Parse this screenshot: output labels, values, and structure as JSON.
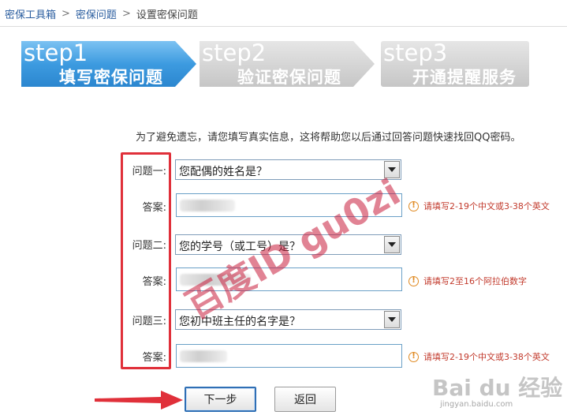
{
  "breadcrumb": {
    "items": [
      "密保工具箱",
      "密保问题",
      "设置密保问题"
    ],
    "separator": ">"
  },
  "steps": [
    {
      "num": "step1",
      "title": "填写密保问题",
      "active": true
    },
    {
      "num": "step2",
      "title": "验证密保问题",
      "active": false
    },
    {
      "num": "step3",
      "title": "开通提醒服务",
      "active": false
    }
  ],
  "intro": "为了避免遗忘，请您填写真实信息，这将帮助您以后通过回答问题快速找回QQ密码。",
  "questions": [
    {
      "label": "问题一:",
      "selected": "您配偶的姓名是？",
      "answer_label": "答案:",
      "hint": "请填写2-19个中文或3-38个英文"
    },
    {
      "label": "问题二:",
      "selected": "您的学号（或工号）是？",
      "answer_label": "答案:",
      "hint": "请填写2至16个阿拉伯数字"
    },
    {
      "label": "问题三:",
      "selected": "您初中班主任的名字是？",
      "answer_label": "答案:",
      "hint": "请填写2-19个中文或3-38个英文"
    }
  ],
  "buttons": {
    "next": "下一步",
    "back": "返回"
  },
  "watermark": "百度ID gu0zi",
  "baidu": {
    "logo": "Bai du 经验",
    "url": "jingyan.baidu.com"
  },
  "colors": {
    "step_active": "#3d9be0",
    "step_inactive": "#cfcfcf",
    "highlight": "#e0303a",
    "hint_text": "#c23a2c",
    "link": "#2a5d9f"
  }
}
